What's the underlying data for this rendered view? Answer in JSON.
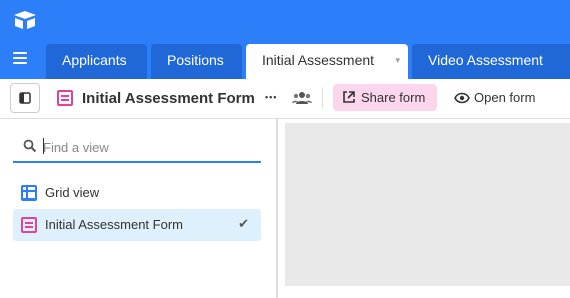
{
  "app": {
    "logo_icon": "airtable-logo-icon",
    "brand_color": "#2d7ff9"
  },
  "tabs": [
    {
      "label": "Applicants",
      "active": false
    },
    {
      "label": "Positions",
      "active": false
    },
    {
      "label": "Initial Assessment",
      "active": true,
      "chevron": "▾"
    },
    {
      "label": "Video Assessment",
      "active": false
    }
  ],
  "viewbar": {
    "title": "Initial Assessment Form",
    "more": "•••",
    "share_label": "Share form",
    "open_label": "Open form",
    "share_color": "#fbd6ec"
  },
  "sidebar": {
    "search_placeholder": "Find a view",
    "views": [
      {
        "label": "Grid view",
        "icon": "grid-icon",
        "selected": false
      },
      {
        "label": "Initial Assessment Form",
        "icon": "form-icon",
        "selected": true,
        "check": "✔"
      }
    ]
  }
}
